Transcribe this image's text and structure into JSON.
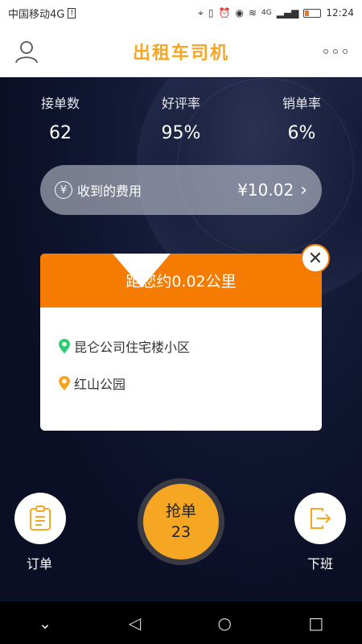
{
  "status": {
    "carrier": "中国移动4G",
    "network": "4G",
    "time": "12:24"
  },
  "header": {
    "title": "出租车司机",
    "user_icon": "user-icon",
    "more_icon": "more-icon"
  },
  "stats": [
    {
      "label": "接单数",
      "value": "62"
    },
    {
      "label": "好评率",
      "value": "95%"
    },
    {
      "label": "销单率",
      "value": "6%"
    }
  ],
  "fee": {
    "label": "收到的费用",
    "amount": "¥10.02"
  },
  "order_popup": {
    "distance": "距您约0.02公里",
    "from": "昆仑公司住宅楼小区",
    "to": "红山公园",
    "colors": {
      "head": "#f57c00",
      "start_pin": "#2ecc71",
      "end_pin": "#f5a623"
    }
  },
  "actions": {
    "left_label": "订单",
    "right_label": "下班",
    "grab_label": "抢单",
    "grab_count": "23"
  }
}
